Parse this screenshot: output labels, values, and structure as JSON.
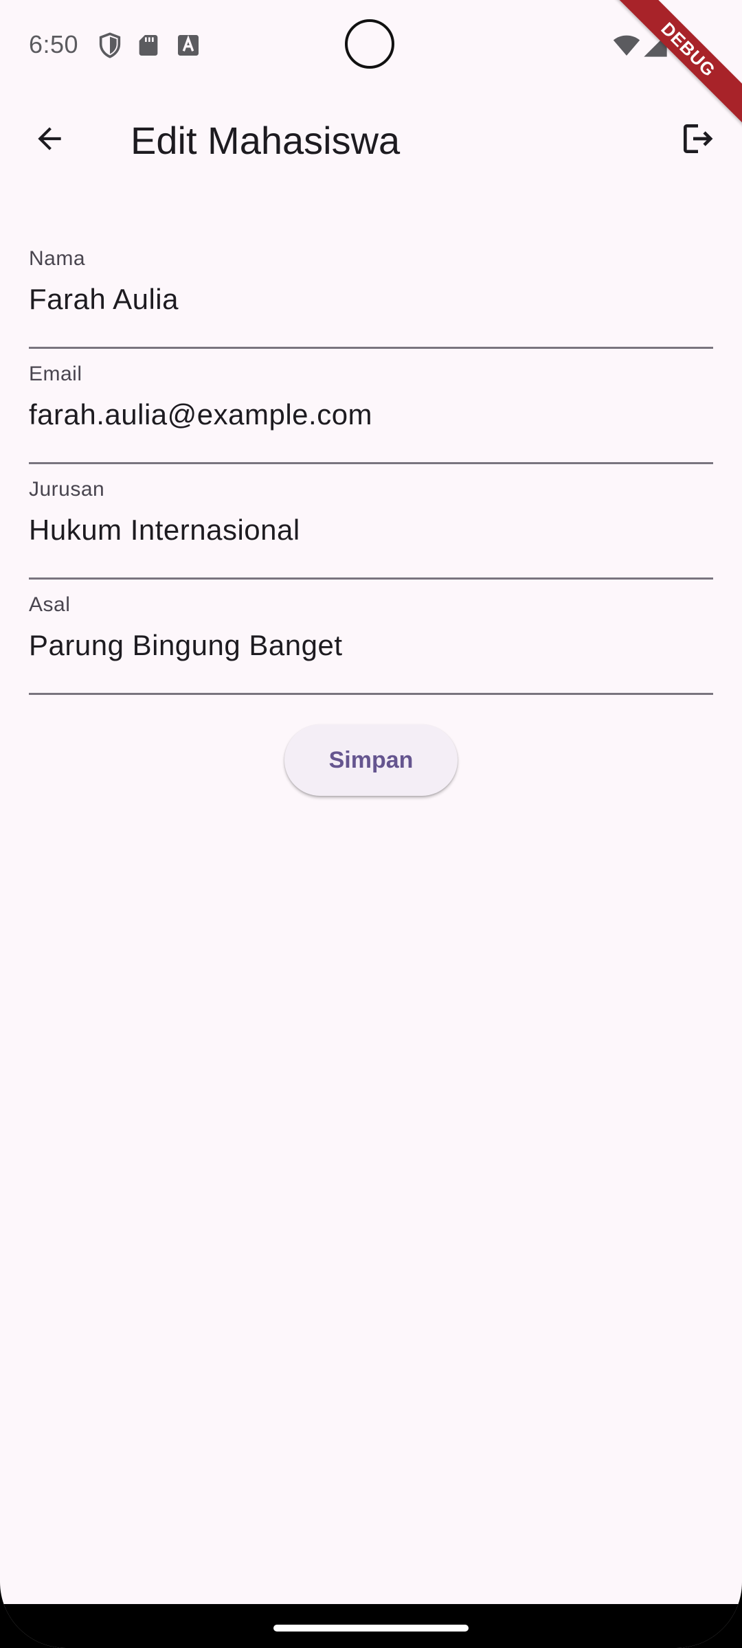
{
  "status_bar": {
    "time": "6:50",
    "left_icons": [
      "shield-icon",
      "sd-card-icon",
      "font-a-icon"
    ],
    "right_icons": [
      "wifi-icon",
      "cell-signal-icon",
      "battery-icon"
    ]
  },
  "debug_banner": "DEBUG",
  "app_bar": {
    "title": "Edit Mahasiswa",
    "back_icon": "arrow-back-icon",
    "action_icon": "logout-icon"
  },
  "form": {
    "fields": [
      {
        "label": "Nama",
        "value": "Farah Aulia"
      },
      {
        "label": "Email",
        "value": "farah.aulia@example.com"
      },
      {
        "label": "Jurusan",
        "value": "Hukum Internasional"
      },
      {
        "label": "Asal",
        "value": "Parung Bingung Banget"
      }
    ],
    "submit_label": "Simpan"
  },
  "colors": {
    "background": "#fdf7fb",
    "primary": "#65558f",
    "button_surface": "#f4eef6",
    "text": "#1d1b20",
    "label": "#49454f",
    "underline": "#79747e",
    "debug_ribbon": "#a82329"
  }
}
